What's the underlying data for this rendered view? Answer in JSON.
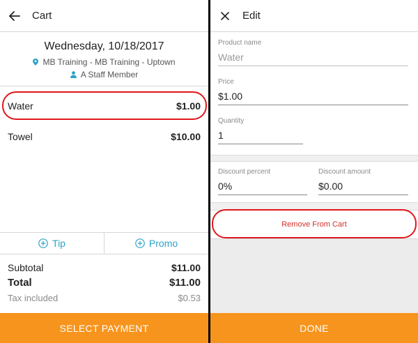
{
  "cart": {
    "back_icon": "arrow-left-icon",
    "title": "Cart",
    "date": "Wednesday, 10/18/2017",
    "location": "MB Training - MB Training - Uptown",
    "staff": "A Staff Member",
    "items": [
      {
        "name": "Water",
        "price": "$1.00"
      },
      {
        "name": "Towel",
        "price": "$10.00"
      }
    ],
    "tip_label": "Tip",
    "promo_label": "Promo",
    "summary": {
      "subtotal_label": "Subtotal",
      "subtotal_value": "$11.00",
      "total_label": "Total",
      "total_value": "$11.00",
      "tax_label": "Tax included",
      "tax_value": "$0.53"
    },
    "select_payment_label": "SELECT PAYMENT"
  },
  "edit": {
    "close_icon": "close-icon",
    "title": "Edit",
    "product_name_label": "Product name",
    "product_name_value": "Water",
    "price_label": "Price",
    "price_value": "$1.00",
    "quantity_label": "Quantity",
    "quantity_value": "1",
    "discount_percent_label": "Discount percent",
    "discount_percent_value": "0%",
    "discount_amount_label": "Discount amount",
    "discount_amount_value": "$0.00",
    "remove_label": "Remove From Cart",
    "done_label": "DONE"
  },
  "colors": {
    "accent_orange": "#f7941d",
    "link_blue": "#2ba3c9",
    "remove_red": "#d0302a",
    "highlight_red": "#e0161b"
  }
}
